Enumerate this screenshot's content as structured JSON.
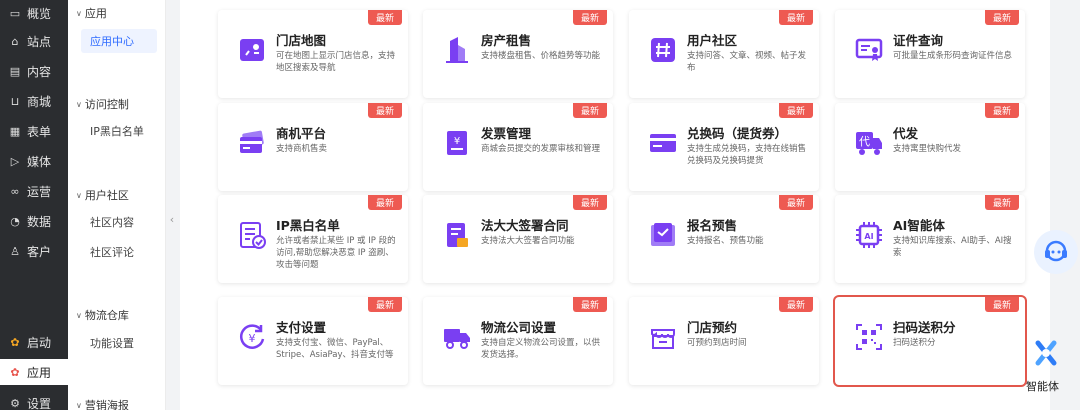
{
  "nav": {
    "items": [
      {
        "label": "概览",
        "icon": "overview-icon",
        "glyph": "▭"
      },
      {
        "label": "站点",
        "icon": "home-icon",
        "glyph": "⌂"
      },
      {
        "label": "内容",
        "icon": "document-icon",
        "glyph": "▤"
      },
      {
        "label": "商城",
        "icon": "cart-icon",
        "glyph": "⊔"
      },
      {
        "label": "表单",
        "icon": "form-icon",
        "glyph": "▦"
      },
      {
        "label": "媒体",
        "icon": "video-icon",
        "glyph": "▷"
      },
      {
        "label": "运营",
        "icon": "link-icon",
        "glyph": "∞"
      },
      {
        "label": "数据",
        "icon": "pie-chart-icon",
        "glyph": "◔"
      },
      {
        "label": "客户",
        "icon": "user-icon",
        "glyph": "♙"
      },
      {
        "label": "启动",
        "icon": "launch-icon",
        "glyph": "✿"
      },
      {
        "label": "应用",
        "icon": "apps-icon",
        "glyph": "✿"
      },
      {
        "label": "设置",
        "icon": "settings-icon",
        "glyph": "⚙"
      }
    ]
  },
  "subnav": {
    "groups": [
      {
        "label": "应用",
        "items": [
          "应用中心"
        ]
      },
      {
        "label": "访问控制",
        "items": [
          "IP黑白名单"
        ]
      },
      {
        "label": "用户社区",
        "items": [
          "社区内容",
          "社区评论"
        ]
      },
      {
        "label": "物流仓库",
        "items": [
          "功能设置"
        ]
      },
      {
        "label": "营销海报",
        "items": []
      }
    ]
  },
  "cards": [
    {
      "title": "门店地图",
      "desc": "可在地图上显示门店信息，支持地区搜索及导航",
      "badge": "最新",
      "icon": "map-icon"
    },
    {
      "title": "房产租售",
      "desc": "支持楼盘租售、价格趋势等功能",
      "badge": "最新",
      "icon": "building-icon"
    },
    {
      "title": "用户社区",
      "desc": "支持问答、文章、视频、帖子发布",
      "badge": "最新",
      "icon": "hashtag-icon"
    },
    {
      "title": "证件查询",
      "desc": "可批量生成条形码查询证件信息",
      "badge": "最新",
      "icon": "certificate-icon"
    },
    {
      "title": "商机平台",
      "desc": "支持商机售卖",
      "badge": "最新",
      "icon": "card-icon"
    },
    {
      "title": "发票管理",
      "desc": "商城会员提交的发票审核和管理",
      "badge": "最新",
      "icon": "invoice-icon"
    },
    {
      "title": "兑换码（提货券）",
      "desc": "支持生成兑换码，支持在线销售兑换码及兑换码提货",
      "badge": "最新",
      "icon": "coupon-icon"
    },
    {
      "title": "代发",
      "desc": "支持寓里快购代发",
      "badge": "最新",
      "icon": "delivery-truck-icon"
    },
    {
      "title": "IP黑白名单",
      "desc": "允许或者禁止某些 IP 或 IP 段的访问,帮助您解决恶意 IP 盗刷、攻击等问题",
      "badge": "最新",
      "icon": "checklist-icon"
    },
    {
      "title": "法大大签署合同",
      "desc": "支持法大大签署合同功能",
      "badge": "最新",
      "icon": "contract-icon"
    },
    {
      "title": "报名预售",
      "desc": "支持报名、预售功能",
      "badge": "最新",
      "icon": "signup-icon"
    },
    {
      "title": "AI智能体",
      "desc": "支持知识库搜索、AI助手、AI搜索",
      "badge": "最新",
      "icon": "ai-chip-icon"
    },
    {
      "title": "支付设置",
      "desc": "支持支付宝、微信、PayPal、Stripe、AsiaPay、抖音支付等",
      "badge": "最新",
      "icon": "payment-icon"
    },
    {
      "title": "物流公司设置",
      "desc": "支持自定义物流公司设置，以供发货选择。",
      "badge": "最新",
      "icon": "truck-icon"
    },
    {
      "title": "门店预约",
      "desc": "可预约到店时间",
      "badge": "最新",
      "icon": "store-icon"
    },
    {
      "title": "扫码送积分",
      "desc": "扫码送积分",
      "badge": "最新",
      "icon": "qr-code-icon"
    }
  ],
  "floating": {
    "agent_label": "智能体"
  },
  "colors": {
    "accent": "#7a3ff2",
    "badge": "#ee5a52",
    "highlight": "#e2574c",
    "link": "#2f6bff"
  }
}
